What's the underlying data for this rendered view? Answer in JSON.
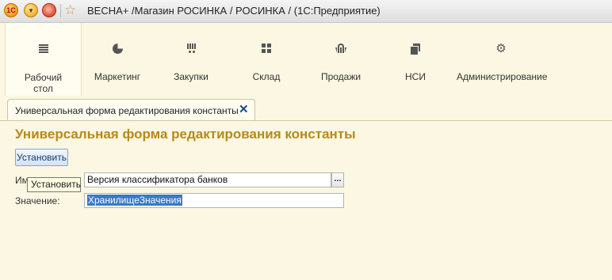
{
  "titlebar": {
    "logo_text": "1С",
    "title": "ВЕСНА+ /Магазин РОСИНКА / РОСИНКА /  (1С:Предприятие)"
  },
  "sections": [
    {
      "label": "Рабочий стол",
      "icon": "list-icon"
    },
    {
      "label": "Маркетинг",
      "icon": "pie-chart-icon"
    },
    {
      "label": "Закупки",
      "icon": "cart-icon"
    },
    {
      "label": "Склад",
      "icon": "grid-icon"
    },
    {
      "label": "Продажи",
      "icon": "basket-icon"
    },
    {
      "label": "НСИ",
      "icon": "books-icon"
    },
    {
      "label": "Администрирование",
      "icon": "gear-icon"
    }
  ],
  "tab": {
    "label": "Универсальная форма редактирования константы",
    "close_glyph": "✕"
  },
  "form": {
    "title": "Универсальная форма редактирования константы",
    "set_button": "Установить",
    "name_label": "Имя:",
    "name_value": "Версия классификатора банков",
    "choose_glyph": "...",
    "value_label": "Значение:",
    "value_value": "ХранилищеЗначения",
    "tooltip": "Установить"
  },
  "colors": {
    "background": "#fbf7e2",
    "form_title": "#b58a1a",
    "button_border": "#7ea7d8",
    "selection": "#3a78c8"
  }
}
